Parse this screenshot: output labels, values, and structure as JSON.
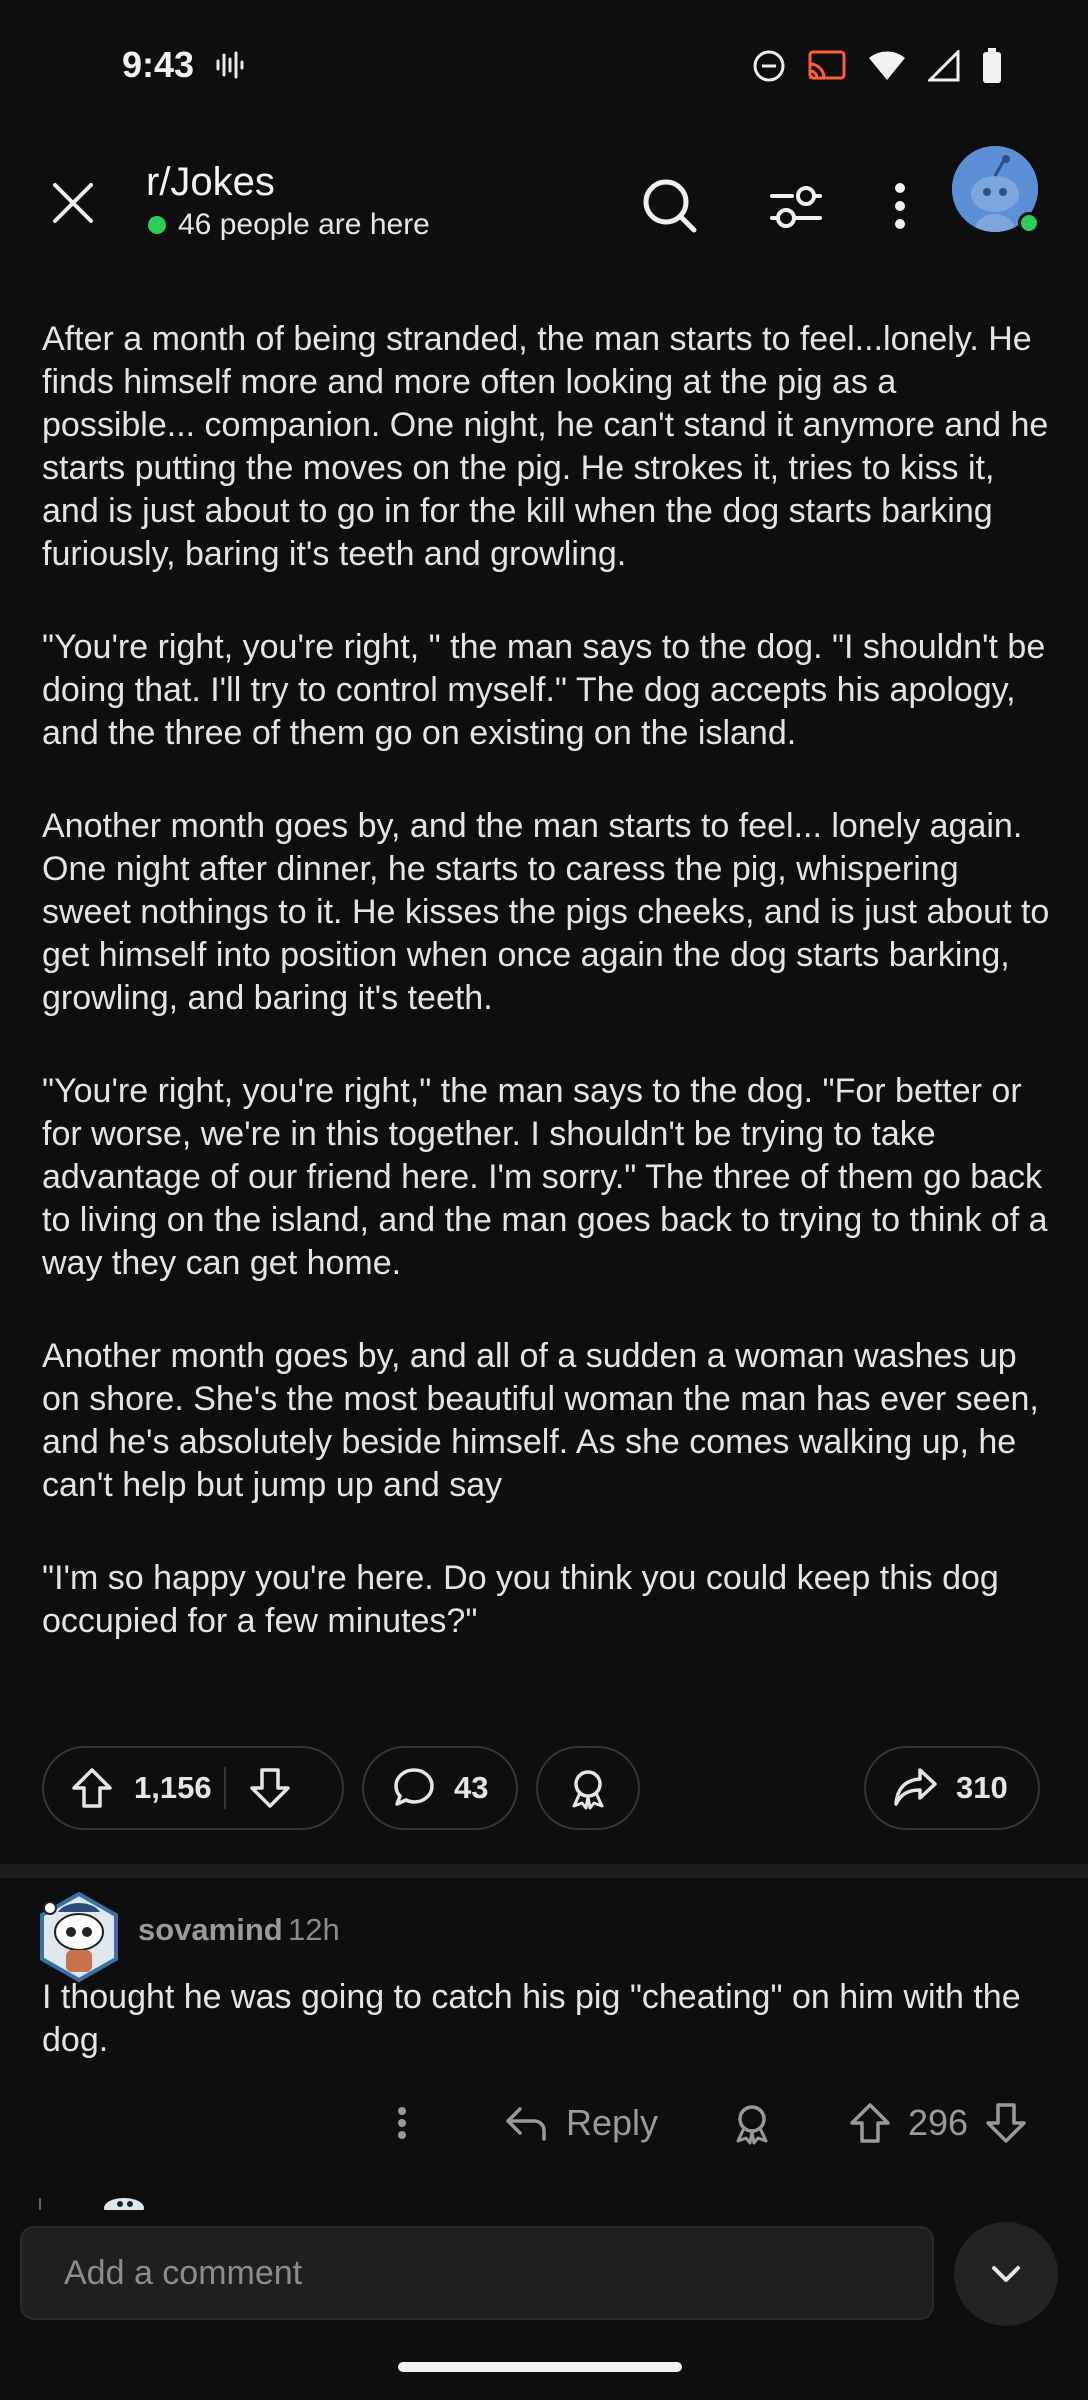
{
  "status_bar": {
    "time": "9:43",
    "icons": [
      "sound-wave-icon",
      "do-not-disturb-icon",
      "cast-icon",
      "wifi-icon",
      "cellular-signal-icon",
      "battery-icon"
    ]
  },
  "header": {
    "subreddit": "r/Jokes",
    "online_text": "46 people are here",
    "online_color": "#2ecc5a"
  },
  "post": {
    "paragraphs": [
      "After a month of being stranded, the man starts to feel...lonely. He finds himself more and more often looking at the pig as a possible... companion. One night, he can't stand it anymore and he starts putting the moves on the pig. He strokes it, tries to kiss it, and is just about to go in for the kill when the dog starts barking furiously, baring it's teeth and growling.",
      "\"You're right, you're right, \" the man says to the dog. \"I shouldn't be doing that. I'll try to control myself.\" The dog accepts his apology, and the three of them go on existing on the island.",
      "Another month goes by, and the man starts to feel... lonely again. One night after dinner, he starts to caress the pig, whispering sweet nothings to it. He kisses the pigs cheeks, and is just about to get himself into position when once again the dog starts barking, growling, and baring it's teeth.",
      "\"You're right, you're right,\" the man says to the dog. \"For better or for worse, we're in this together. I shouldn't be trying to take advantage of our friend here. I'm sorry.\" The three of them go back to living on the island, and the man goes back to trying to think of a way they can get home.",
      "Another month goes by, and all of a sudden a woman washes up on shore. She's the most beautiful woman the man has ever seen, and he's absolutely beside himself. As she comes walking up, he can't help but jump up and say",
      "\"I'm so happy you're here. Do you think you could keep this dog occupied for a few minutes?\""
    ],
    "upvotes": "1,156",
    "comments": "43",
    "shares": "310"
  },
  "comment": {
    "username": "sovamind",
    "age": "12h",
    "text": "I thought he was going to catch his pig \"cheating\" on him with the dog.",
    "reply_label": "Reply",
    "score": "296"
  },
  "composer": {
    "placeholder": "Add a comment"
  },
  "colors": {
    "background": "#0e0e0f",
    "text": "#e4e4e4",
    "muted": "#9a9a9a",
    "pill_border": "#343536",
    "avatar_blue": "#5b8fd6"
  }
}
